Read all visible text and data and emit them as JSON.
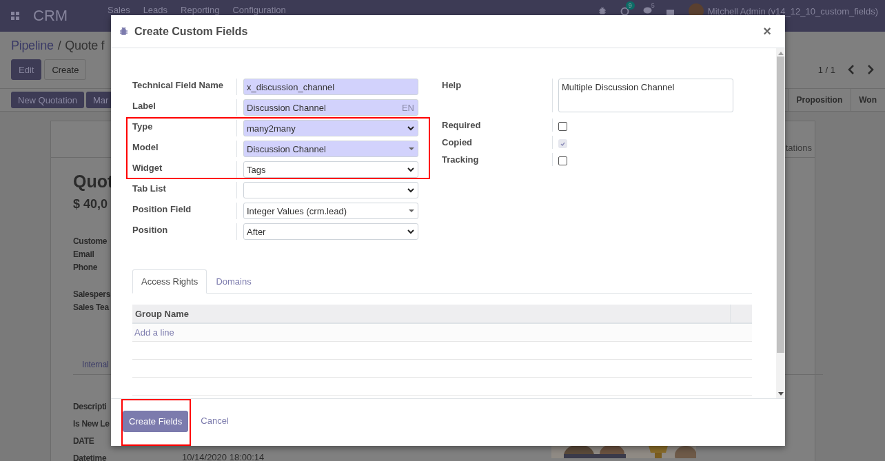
{
  "navbar": {
    "app": "CRM",
    "menus": [
      "Sales",
      "Leads",
      "Reporting",
      "Configuration"
    ],
    "activity_count": "9",
    "message_count": "5",
    "user": "Mitchell Admin (v14_12_10_custom_fields)"
  },
  "breadcrumb": {
    "parent": "Pipeline",
    "separator": "/",
    "current": "Quote f"
  },
  "actions": [
    "Edit",
    "Create"
  ],
  "pager": "1 / 1",
  "statusbar": {
    "buttons": [
      "New Quotation",
      "Mar"
    ],
    "stages": [
      "Proposition",
      "Won"
    ]
  },
  "sheet": {
    "tab": "tations",
    "title": "Quot",
    "amount": "$ 40,0",
    "label_groups": [
      [
        "Custome",
        "Email",
        "Phone"
      ],
      [
        "Salespers",
        "Sales Tea"
      ]
    ],
    "notebook_tab": "Internal",
    "lower_labels": [
      "Descripti",
      "Is New Le",
      "DATE",
      "Datetime"
    ],
    "datetime_value": "10/14/2020 18:00:14",
    "photo": {
      "kind": "picture"
    }
  },
  "dialog": {
    "title": "Create Custom Fields",
    "close_label": "×",
    "left_fields": [
      {
        "label": "Technical Field Name",
        "kind": "input",
        "value": "x_discussion_channel",
        "required": true,
        "highlighted": false
      },
      {
        "label": "Label",
        "kind": "translatable",
        "value": "Discussion Channel",
        "lang": "EN",
        "required": true,
        "highlighted": false
      },
      {
        "label": "Type",
        "kind": "select",
        "value": "many2many",
        "required": true,
        "highlighted": true
      },
      {
        "label": "Model",
        "kind": "many2one",
        "value": "Discussion Channel",
        "required": true,
        "highlighted": true
      },
      {
        "label": "Widget",
        "kind": "select",
        "value": "Tags",
        "required": false,
        "highlighted": true
      },
      {
        "label": "Tab List",
        "kind": "select",
        "required": false,
        "highlighted": false
      },
      {
        "label": "Position Field",
        "kind": "many2one",
        "value": "Integer Values (crm.lead)",
        "required": false,
        "highlighted": false
      },
      {
        "label": "Position",
        "kind": "select",
        "value": "After",
        "required": false,
        "highlighted": false
      }
    ],
    "right_fields": [
      {
        "label": "Help",
        "kind": "text",
        "value": "Multiple Discussion Channel"
      },
      {
        "label": "Required",
        "kind": "checkbox",
        "checked": false,
        "disabled": false
      },
      {
        "label": "Copied",
        "kind": "checkbox",
        "checked": true,
        "disabled": true
      },
      {
        "label": "Tracking",
        "kind": "checkbox",
        "checked": false,
        "disabled": false
      }
    ],
    "tabs": [
      {
        "label": "Access Rights",
        "selected": true
      },
      {
        "label": "Domains",
        "selected": false
      }
    ],
    "table": {
      "columns": [
        "Group Name"
      ],
      "add_line": "Add a line"
    },
    "primary_button": {
      "label": "Create Fields",
      "highlighted": true
    },
    "cancel": "Cancel"
  }
}
